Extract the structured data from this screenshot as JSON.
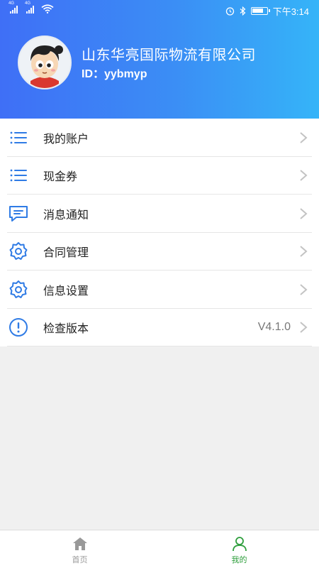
{
  "status_bar": {
    "signal_1": "4G",
    "signal_2": "4G",
    "time": "下午3:14"
  },
  "profile": {
    "company_name": "山东华亮国际物流有限公司",
    "user_id": "ID：yybmyp"
  },
  "menu": {
    "items": [
      {
        "label": "我的账户",
        "icon": "list-icon",
        "value": ""
      },
      {
        "label": "现金券",
        "icon": "list-icon",
        "value": ""
      },
      {
        "label": "消息通知",
        "icon": "message-icon",
        "value": ""
      },
      {
        "label": "合同管理",
        "icon": "gear-icon",
        "value": ""
      },
      {
        "label": "信息设置",
        "icon": "gear-icon",
        "value": ""
      },
      {
        "label": "检查版本",
        "icon": "exclamation-icon",
        "value": "V4.1.0"
      }
    ]
  },
  "tabbar": {
    "tabs": [
      {
        "label": "首页",
        "icon": "home-icon",
        "active": false
      },
      {
        "label": "我的",
        "icon": "person-icon",
        "active": true
      }
    ]
  },
  "colors": {
    "header_start": "#3f6ff6",
    "header_end": "#35b4f8",
    "icon_blue": "#2f7be5",
    "tab_active": "#2e9e3c",
    "tab_inactive": "#999999"
  }
}
